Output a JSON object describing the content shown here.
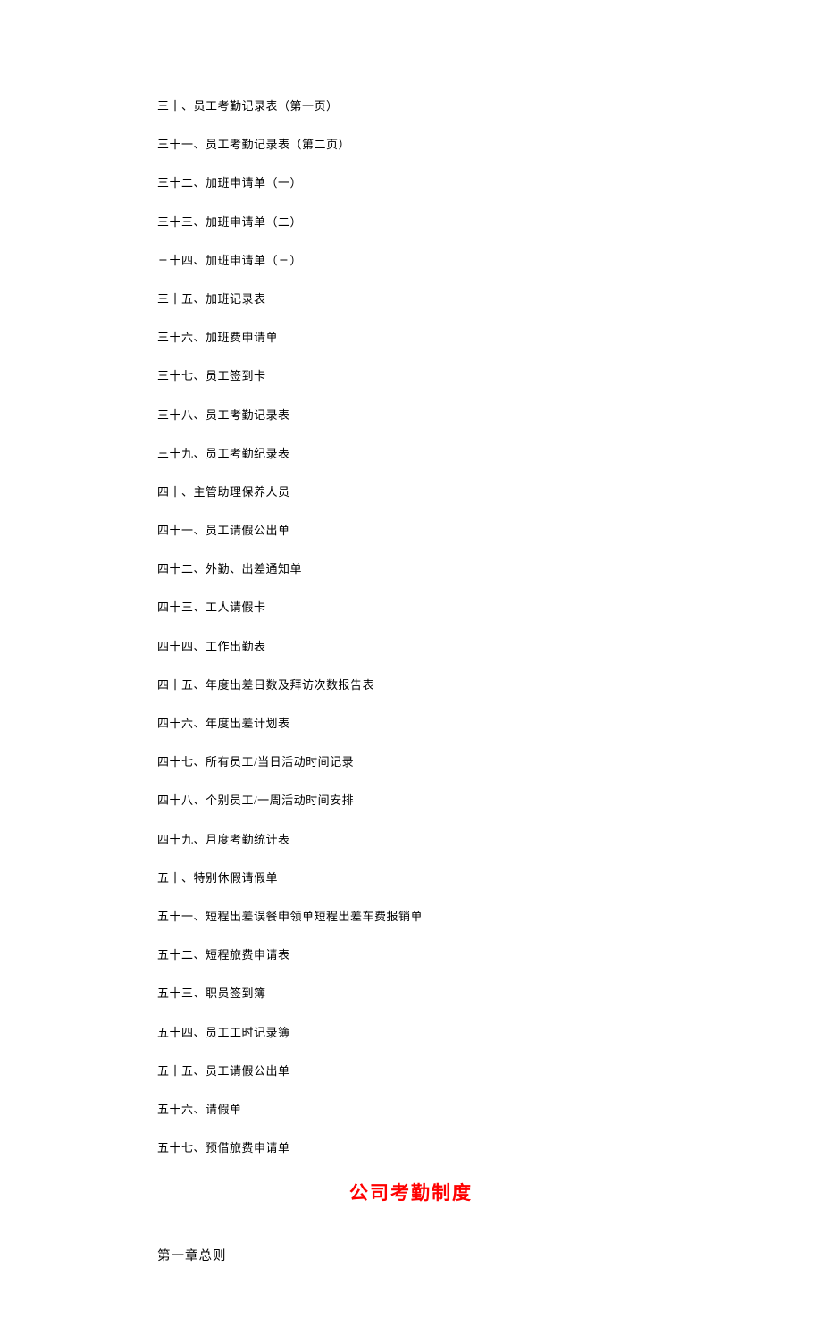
{
  "toc": {
    "items": [
      "三十、员工考勤记录表（第一页）",
      "三十一、员工考勤记录表（第二页）",
      "三十二、加班申请单（一）",
      "三十三、加班申请单（二）",
      "三十四、加班申请单（三）",
      "三十五、加班记录表",
      "三十六、加班费申请单",
      "三十七、员工签到卡",
      "三十八、员工考勤记录表",
      "三十九、员工考勤纪录表",
      "四十、主管助理保养人员",
      "四十一、员工请假公出单",
      "四十二、外勤、出差通知单",
      "四十三、工人请假卡",
      "四十四、工作出勤表",
      "四十五、年度出差日数及拜访次数报告表",
      "四十六、年度出差计划表",
      "四十七、所有员工/当日活动时间记录",
      "四十八、个别员工/一周活动时间安排",
      "四十九、月度考勤统计表",
      "五十、特别休假请假单",
      "五十一、短程出差误餐申领单短程出差车费报销单",
      "五十二、短程旅费申请表",
      "五十三、职员签到簿",
      "五十四、员工工时记录簿",
      "五十五、员工请假公出单",
      "五十六、请假单",
      "五十七、预借旅费申请单"
    ]
  },
  "section_title": "公司考勤制度",
  "chapter_heading": "第一章总则"
}
